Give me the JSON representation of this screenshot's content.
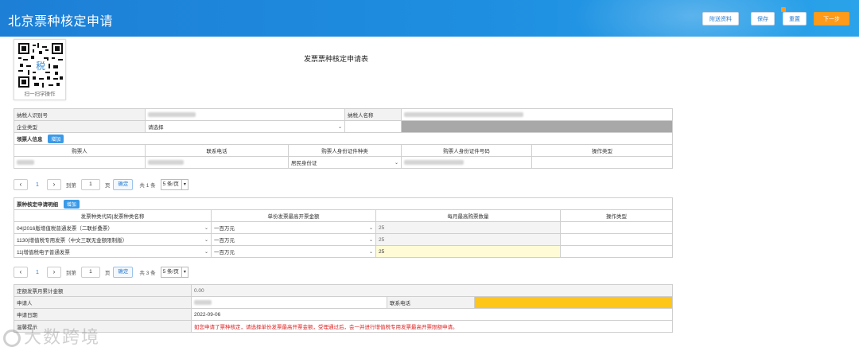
{
  "header": {
    "title": "北京票种核定申请",
    "buttons": {
      "attach": "附送资料",
      "save": "保存",
      "reset": "重置",
      "next": "下一步"
    }
  },
  "qr": {
    "caption": "扫一扫学操作"
  },
  "form_title": "发票票种核定申请表",
  "taxpayer": {
    "id_label": "纳税人识别号",
    "name_label": "纳税人名称",
    "enterprise_type_label": "企业类型",
    "enterprise_type_value": "请选择"
  },
  "buyer_section": {
    "title": "领票人信息",
    "add_label": "增加",
    "columns": [
      "购票人",
      "联系电话",
      "购票人身份证件种类",
      "购票人身份证件号码",
      "操作类型"
    ],
    "row": {
      "id_type": "居民身份证"
    }
  },
  "pager1": {
    "current": "1",
    "goto_label": "到第",
    "page_input": "1",
    "page_unit": "页",
    "confirm": "确定",
    "total": "共 1 条",
    "page_size": "5 条/页"
  },
  "detail_section": {
    "title": "票种核定申请明细",
    "add_label": "增加",
    "columns": [
      "发票种类代码|发票种类名称",
      "单份发票最高开票金额",
      "每月最高购票数量",
      "操作类型"
    ],
    "rows": [
      {
        "type": "04|2016版增值税普通发票（二联折叠票）",
        "amount": "一百万元",
        "qty": "25"
      },
      {
        "type": "1130|增值税专用发票（中文三联无金额限制版）",
        "amount": "一百万元",
        "qty": "25"
      },
      {
        "type": "11|增值税电子普通发票",
        "amount": "一百万元",
        "qty": "25"
      }
    ]
  },
  "pager2": {
    "current": "1",
    "goto_label": "到第",
    "page_input": "1",
    "page_unit": "页",
    "confirm": "确定",
    "total": "共 3 条",
    "page_size": "5 条/页"
  },
  "summary": {
    "quota_label": "定额发票月累计金额",
    "quota_value": "0.00",
    "applicant_label": "申请人",
    "phone_label": "联系电话",
    "date_label": "申请日期",
    "date_value": "2022-09-06",
    "remark_label": "温馨提示",
    "remark_text": "如您申请了票种核定，请选择单份发票最高开票金额，受理通过后，会一并进行增值税专用发票最高开票限额申请。"
  },
  "watermark": "大数跨境",
  "colors": {
    "header": "#1e8ee0",
    "next_button": "#ff9a1a",
    "highlight": "#ffc61a",
    "note": "#e02020"
  }
}
